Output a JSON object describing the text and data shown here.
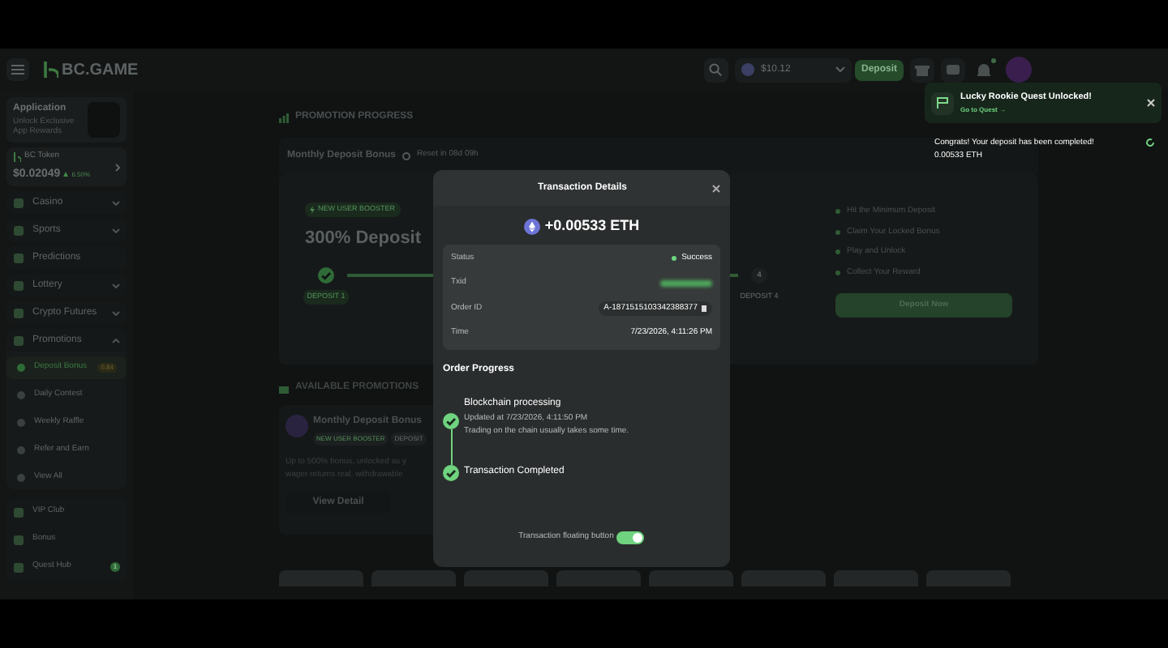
{
  "header": {
    "logo": "BC.GAME",
    "balance": "$10.12",
    "deposit_button": "Deposit",
    "notification_dot": true
  },
  "sidebar": {
    "app_promo": {
      "title": "Application",
      "subtitle": "Unlock Exclusive App Rewards"
    },
    "token": {
      "name": "BC Token",
      "price": "$0.02049",
      "change": "6.50%"
    },
    "items": [
      {
        "label": "Casino",
        "kind": "group",
        "expanded": false
      },
      {
        "label": "Sports",
        "kind": "group",
        "expanded": false
      },
      {
        "label": "Predictions",
        "kind": "link"
      },
      {
        "label": "Lottery",
        "kind": "group",
        "expanded": false
      },
      {
        "label": "Crypto Futures",
        "kind": "group",
        "expanded": false
      },
      {
        "label": "Promotions",
        "kind": "group",
        "expanded": true,
        "children": [
          {
            "label": "Deposit Bonus",
            "selected": true,
            "badge": "0.84"
          },
          {
            "label": "Daily Contest",
            "selected": false
          },
          {
            "label": "Weekly Raffle",
            "selected": false
          },
          {
            "label": "Refer and Earn",
            "selected": false
          },
          {
            "label": "View All",
            "selected": false
          }
        ]
      }
    ],
    "bottom_items": [
      {
        "label": "VIP Club"
      },
      {
        "label": "Bonus"
      },
      {
        "label": "Quest Hub",
        "badge": "1"
      }
    ]
  },
  "promotion_progress": {
    "heading": "PROMOTION PROGRESS",
    "title": "Monthly Deposit Bonus",
    "reset": "Reset in 08d 09h",
    "tag": "NEW USER BOOSTER",
    "headline": "300% Deposit",
    "steps": [
      {
        "label": "DEPOSIT 1",
        "done": true
      },
      {
        "label": "DEPOSIT 4",
        "done": false,
        "number": "4"
      }
    ],
    "checklist": [
      "Hit the Minimum Deposit",
      "Claim Your Locked Bonus",
      "Play and Unlock",
      "Collect Your Reward"
    ],
    "button": "Deposit Now"
  },
  "available_promotions": {
    "heading": "AVAILABLE PROMOTIONS",
    "card": {
      "title": "Monthly Deposit Bonus",
      "tags": [
        "NEW USER BOOSTER",
        "DEPOSIT"
      ],
      "description": [
        "Up to 500% bonus, unlocked as y",
        "wager returns real, withdrawable"
      ],
      "button": "View Detail"
    }
  },
  "modal": {
    "title": "Transaction Details",
    "amount": "+0.00533 ETH",
    "rows": [
      {
        "label": "Status",
        "value": "Success",
        "kind": "status"
      },
      {
        "label": "Txid",
        "value": "",
        "kind": "hidden"
      },
      {
        "label": "Order ID",
        "value": "A-1871515103342388377",
        "kind": "copy"
      },
      {
        "label": "Time",
        "value": "7/23/2026, 4:11:26 PM",
        "kind": "text"
      }
    ],
    "progress_heading": "Order Progress",
    "steps": [
      {
        "title": "Blockchain processing",
        "done": true,
        "lines": [
          "Updated at 7/23/2026, 4:11:50 PM",
          "Trading on the chain usually takes some time."
        ]
      },
      {
        "title": "Transaction Completed",
        "done": true
      }
    ],
    "toggle": {
      "label": "Transaction floating button",
      "on": true
    }
  },
  "toast": {
    "title": "Lucky Rookie Quest Unlocked!",
    "link": "Go to Quest →"
  },
  "message": {
    "lines": [
      "Congrats! Your deposit has been completed!",
      "0.00533 ETH"
    ]
  }
}
